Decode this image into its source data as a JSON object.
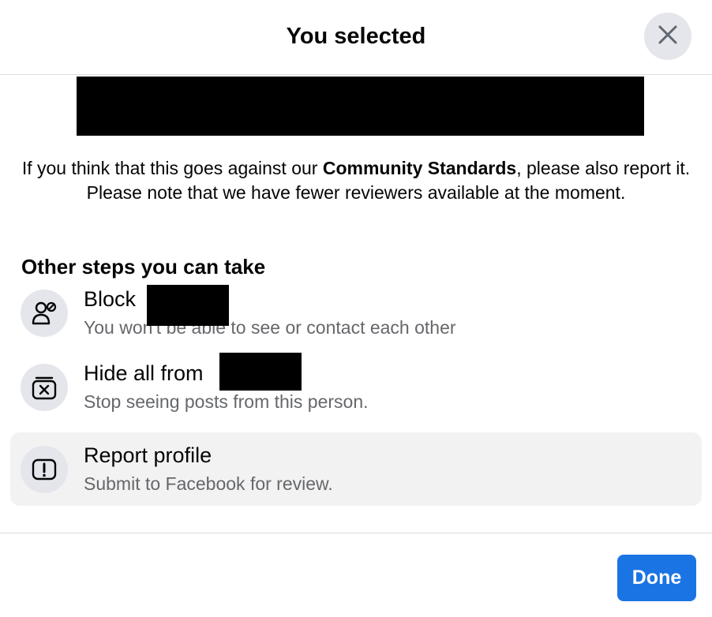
{
  "header": {
    "title": "You selected",
    "close_icon": "close-icon"
  },
  "notice": {
    "before": "If you think that this goes against our ",
    "bold": "Community Standards",
    "after": ", please also report it. Please note that we have fewer reviewers available at the moment."
  },
  "section_title": "Other steps you can take",
  "options": [
    {
      "label": "Block",
      "sub": "You won't be able to see or contact each other",
      "icon": "block-person-icon"
    },
    {
      "label": "Hide all from",
      "sub": "Stop seeing posts from this person.",
      "icon": "hide-box-icon"
    },
    {
      "label": "Report profile",
      "sub": "Submit to Facebook for review.",
      "icon": "report-alert-icon"
    }
  ],
  "footer": {
    "done_label": "Done"
  },
  "colors": {
    "accent": "#1b74e4",
    "icon_bg": "#e4e6eb",
    "highlight_bg": "#f2f2f2",
    "secondary_text": "#65676b"
  }
}
